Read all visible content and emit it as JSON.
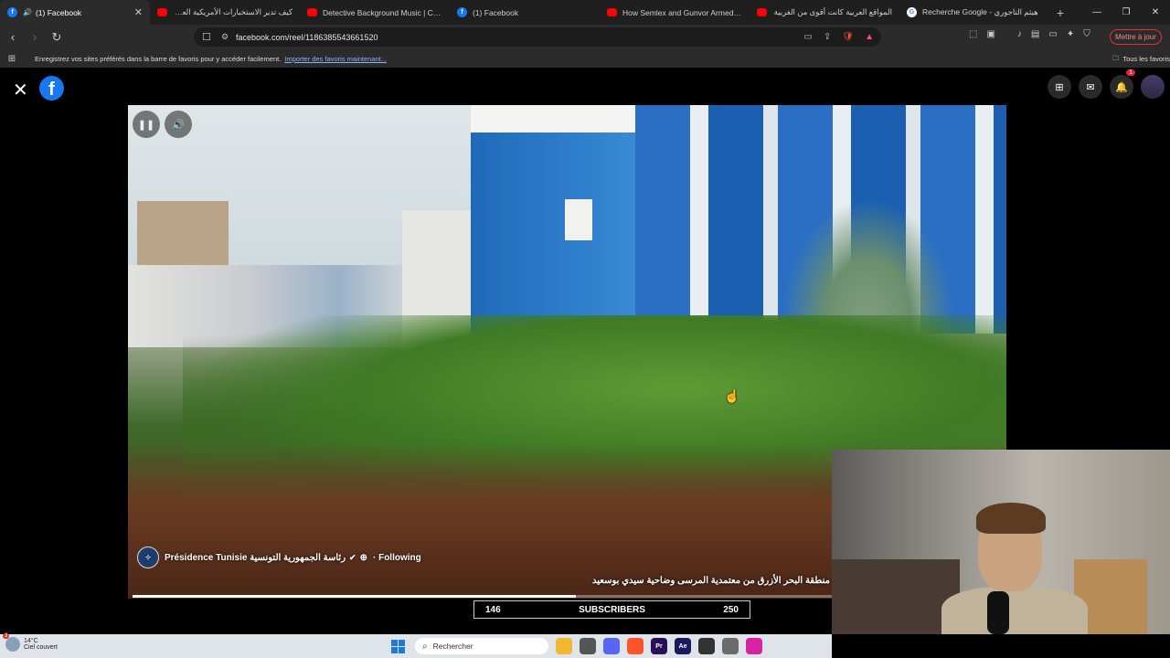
{
  "browser": {
    "tabs": [
      {
        "title": "(1) Facebook",
        "favicon": "facebook-icon",
        "active": true,
        "audio": true
      },
      {
        "title": "كيف تدير الاستخبارات الأمريكية العالم؟",
        "favicon": "youtube-icon"
      },
      {
        "title": "Detective Background Music | Crime",
        "favicon": "youtube-icon"
      },
      {
        "title": "(1) Facebook",
        "favicon": "facebook-icon"
      },
      {
        "title": "How Semlex and Gunvor Armed the",
        "favicon": "youtube-icon"
      },
      {
        "title": "المواقع العربية كانت أقوى من الغربية",
        "favicon": "youtube-icon"
      },
      {
        "title": "Recherche Google - هيثم التاجوري",
        "favicon": "google-icon"
      }
    ],
    "url": "facebook.com/reel/1186385543661520",
    "update_button": "Mettre à jour",
    "bookmarks_message": "Enregistrez vos sites préférés dans la barre de favoris pour y accéder facilement.",
    "bookmarks_import": "Importer des favoris maintenant...",
    "all_bookmarks": "Tous les favoris"
  },
  "facebook": {
    "notification_count": "1",
    "reel": {
      "page_name": "Présidence Tunisie رئاسة الجمهورية التونسية",
      "following": "· Following",
      "caption": "منطقة البحر الأزرق من معتمدية المرسى وضاحية سيدي بوسعيد",
      "progress": 0.51
    }
  },
  "overlay": {
    "left_count": "146",
    "label": "SUBSCRIBERS",
    "right_count": "250"
  },
  "taskbar": {
    "temperature": "14°C",
    "weather": "Ciel couvert",
    "weather_badge": "3",
    "search_placeholder": "Rechercher",
    "apps": [
      {
        "name": "file-explorer-icon",
        "label": "",
        "color": "#f2b732"
      },
      {
        "name": "taskview-icon",
        "label": "",
        "color": "#555555"
      },
      {
        "name": "discord-icon",
        "label": "",
        "color": "#5865f2"
      },
      {
        "name": "brave-icon",
        "label": "",
        "color": "#fb542b"
      },
      {
        "name": "premiere-icon",
        "label": "Pr",
        "color": "#2a0f59"
      },
      {
        "name": "after-effects-icon",
        "label": "Ae",
        "color": "#1a1a5c"
      },
      {
        "name": "davinci-icon",
        "label": "",
        "color": "#333333"
      },
      {
        "name": "calculator-icon",
        "label": "",
        "color": "#6b6b6b"
      },
      {
        "name": "instagram-icon",
        "label": "",
        "color": "#d6249f"
      }
    ]
  }
}
